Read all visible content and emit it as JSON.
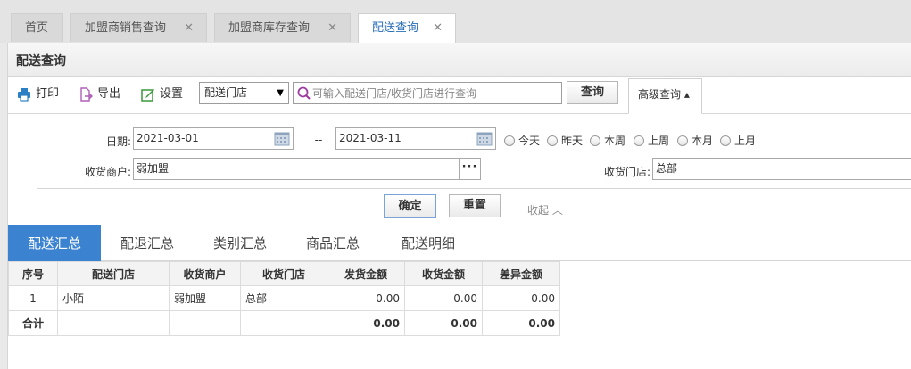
{
  "tabs": [
    {
      "label": "首页",
      "closable": false,
      "active": false
    },
    {
      "label": "加盟商销售查询",
      "closable": true,
      "active": false
    },
    {
      "label": "加盟商库存查询",
      "closable": true,
      "active": false
    },
    {
      "label": "配送查询",
      "closable": true,
      "active": true
    }
  ],
  "close_glyph": "✕",
  "page_title": "配送查询",
  "toolbar": {
    "print_label": "打印",
    "export_label": "导出",
    "settings_label": "设置",
    "scope_select_value": "配送门店",
    "search_placeholder": "可输入配送门店/收货门店进行查询",
    "search_value": "",
    "query_button": "查询",
    "advanced_tab": "高级查询 ▴"
  },
  "filters": {
    "date_label": "日期:",
    "date_from": "2021-03-01",
    "date_sep": "--",
    "date_to": "2021-03-11",
    "quick_dates": [
      "今天",
      "昨天",
      "本周",
      "上周",
      "本月",
      "上月"
    ],
    "merchant_label": "收货商户:",
    "merchant_value": "弱加盟",
    "store_label": "收货门店:",
    "store_value": "总部",
    "confirm_button": "确定",
    "reset_button": "重置",
    "collapse_text": "收起 ︿"
  },
  "summary_tabs": [
    "配送汇总",
    "配退汇总",
    "类别汇总",
    "商品汇总",
    "配送明细"
  ],
  "active_summary_tab": 0,
  "table": {
    "columns": [
      "序号",
      "配送门店",
      "收货商户",
      "收货门店",
      "发货金额",
      "收货金额",
      "差异金额"
    ],
    "rows": [
      [
        "1",
        "小陌",
        "弱加盟",
        "总部",
        "0.00",
        "0.00",
        "0.00"
      ]
    ],
    "total": [
      "合计",
      "",
      "",
      "",
      "0.00",
      "0.00",
      "0.00"
    ]
  },
  "colors": {
    "accent": "#3b82d1",
    "print_icon": "#2b7fc4",
    "export_icon": "#b05fb8",
    "settings_icon": "#3a9a3a",
    "search_icon": "#9b3aa0"
  }
}
